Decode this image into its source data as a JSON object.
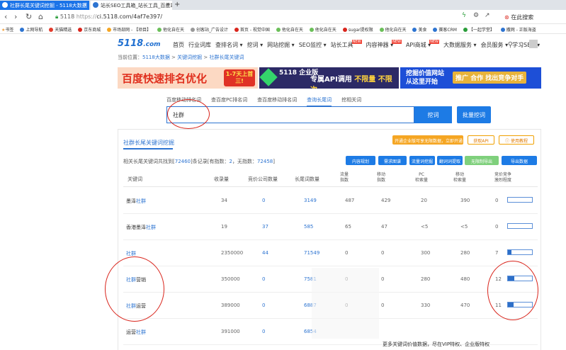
{
  "browser": {
    "tabs": [
      {
        "label": "社群长尾关键词挖掘 - 5118大数据",
        "active": true
      },
      {
        "label": "站长SEO工具箱_站长工具_百度站长...",
        "active": false
      }
    ],
    "new_tab": "+",
    "url_protocol": "https://",
    "url_secure_label": "5118",
    "url": "ci.5118.com/4af7e397/",
    "search_label": "在此搜索",
    "bookmarks": [
      "书签",
      "上网导航",
      "天猫精选",
      "京东商城",
      "市场部网 - 【项目】",
      "他化自在天",
      "创客站_广告设计",
      "首页 - 视觉中国",
      "他化自在天",
      "他化自在天",
      "sugar提权限",
      "他化自在天",
      "美食",
      "赛客CRM",
      "【一起学堂】",
      "撒网 - 正版海盗"
    ]
  },
  "site": {
    "logo": "5118",
    "logo_domain": ".com",
    "nav": [
      {
        "label": "首页",
        "new": false
      },
      {
        "label": "行业词库",
        "new": false
      },
      {
        "label": "查排名词 ▾",
        "new": false
      },
      {
        "label": "挖词 ▾",
        "new": false
      },
      {
        "label": "网站挖掘 ▾",
        "new": false
      },
      {
        "label": "SEO监控 ▾",
        "new": false
      },
      {
        "label": "站长工具",
        "new": true
      },
      {
        "label": "内容神器 ▾",
        "new": true
      },
      {
        "label": "API商城 ▾",
        "new": true
      },
      {
        "label": "大数据服务 ▾",
        "new": false
      },
      {
        "label": "会员服务 ▾",
        "new": false
      },
      {
        "label": "学习SEO ▾",
        "new": false
      }
    ],
    "new_badge": "NEW",
    "breadcrumb": {
      "prefix": "当前位置：",
      "items": [
        "5118大数据",
        "关键词挖掘",
        "社群长尾关键词"
      ],
      "sep": " > "
    }
  },
  "banners": {
    "b1_main": "百度快速排名优化",
    "b1_burst": "1-7天上首三!",
    "b2_brand": "5118 企业版",
    "b2_text_a": "专属API调用",
    "b2_text_b": "不限量 不限次",
    "b3_left": "挖掘价值网站 从这里开始",
    "b3_right": "推广 合作 找出竞争对手"
  },
  "search": {
    "tabs": [
      "百度移动排名词",
      "查百度PC排名词",
      "查百度移动排名词",
      "查询长尾词",
      "挖相关词"
    ],
    "active_tab": 3,
    "value": "社群",
    "dig_button": "挖词",
    "batch_button": "批量挖词"
  },
  "panel": {
    "title": "社群长尾关键词挖掘",
    "vip_notice": "开通企业版可享无限数据，立即开通",
    "api_button": "获取API",
    "help_button": "使用教程",
    "summary_prefix": "相关长尾关键词共找到[",
    "summary_total": "72460",
    "summary_mid": "]条记录[有指数：",
    "summary_indexed": "2",
    "summary_mid2": "，无指数：",
    "summary_unindexed": "72458",
    "summary_suffix": "]",
    "tools": [
      "内容规划",
      "需求图谱",
      "流量词挖掘",
      "翻词词提取",
      "无限制导出",
      "导出数据"
    ],
    "columns": {
      "keyword": "关键词",
      "index": "收录量",
      "bidding": "竞价公司数量",
      "longtail": "长尾词数量",
      "traffic": "流量\n指数",
      "mobile": "移动\n指数",
      "pc_count": "PC\n检索量",
      "mobile_count": "移动\n检索量",
      "competition": "竞价竞争\n激烈程度"
    },
    "rows": [
      {
        "pre": "墨泽",
        "hl": "社群",
        "post": "",
        "index": "34",
        "bidding": "0",
        "longtail": "3149",
        "traffic": "487",
        "mobile": "429",
        "pc": "20",
        "mobile_count": "390",
        "comp": "0",
        "comp_level": 0.0
      },
      {
        "pre": "香港墨泽",
        "hl": "社群",
        "post": "",
        "index": "19",
        "bidding": "37",
        "longtail": "585",
        "traffic": "65",
        "mobile": "47",
        "pc": "<5",
        "mobile_count": "<5",
        "comp": "0",
        "comp_level": 0.0
      },
      {
        "pre": "",
        "hl": "社群",
        "post": "",
        "index": "2350000",
        "bidding": "44",
        "longtail": "71549",
        "traffic": "0",
        "mobile": "0",
        "pc": "300",
        "mobile_count": "280",
        "comp": "7",
        "comp_level": 0.07
      },
      {
        "pre": "",
        "hl": "社群",
        "post": "营销",
        "index": "350000",
        "bidding": "0",
        "longtail": "7581",
        "traffic": "0",
        "mobile": "0",
        "pc": "280",
        "mobile_count": "480",
        "comp": "12",
        "comp_level": 0.12
      },
      {
        "pre": "",
        "hl": "社群",
        "post": "运营",
        "index": "389000",
        "bidding": "0",
        "longtail": "6887",
        "traffic": "0",
        "mobile": "0",
        "pc": "330",
        "mobile_count": "470",
        "comp": "11",
        "comp_level": 0.11
      },
      {
        "pre": "运营",
        "hl": "社群",
        "post": "",
        "index": "391000",
        "bidding": "0",
        "longtail": "6854",
        "traffic": "",
        "mobile": "",
        "pc": "",
        "mobile_count": "",
        "comp": "",
        "comp_level": null
      }
    ],
    "footnote": "更多关键词价值数据，尽在VIP特权、企业版特权"
  }
}
